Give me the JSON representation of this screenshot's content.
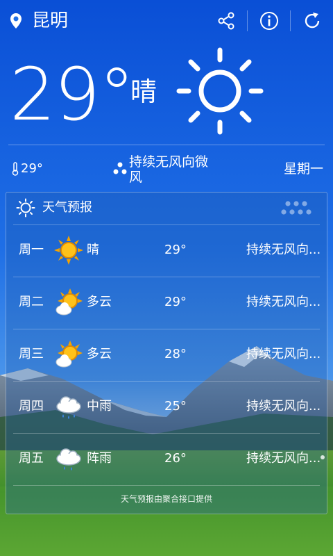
{
  "header": {
    "city": "昆明",
    "location_icon": "location-pin-icon",
    "actions": [
      "share-icon",
      "info-icon",
      "refresh-icon"
    ]
  },
  "current": {
    "temperature": "29°",
    "condition": "晴",
    "feels_temp": "29°",
    "wind": "持续无风向微风",
    "weekday": "星期一"
  },
  "forecast": {
    "title": "天气预报",
    "credit": "天气预报由聚合接口提供",
    "days": [
      {
        "day": "周一",
        "icon": "sunny-icon",
        "condition": "晴",
        "temp": "29°",
        "wind": "持续无风向..."
      },
      {
        "day": "周二",
        "icon": "partly-cloudy-icon",
        "condition": "多云",
        "temp": "29°",
        "wind": "持续无风向..."
      },
      {
        "day": "周三",
        "icon": "partly-cloudy-icon",
        "condition": "多云",
        "temp": "28°",
        "wind": "持续无风向..."
      },
      {
        "day": "周四",
        "icon": "rain-icon",
        "condition": "中雨",
        "temp": "25°",
        "wind": "持续无风向..."
      },
      {
        "day": "周五",
        "icon": "shower-icon",
        "condition": "阵雨",
        "temp": "26°",
        "wind": "持续无风向..."
      }
    ]
  },
  "colors": {
    "sky_top": "#0a4fd6",
    "sky_bottom": "#3c8ff0",
    "grass": "#3f8f2a"
  }
}
